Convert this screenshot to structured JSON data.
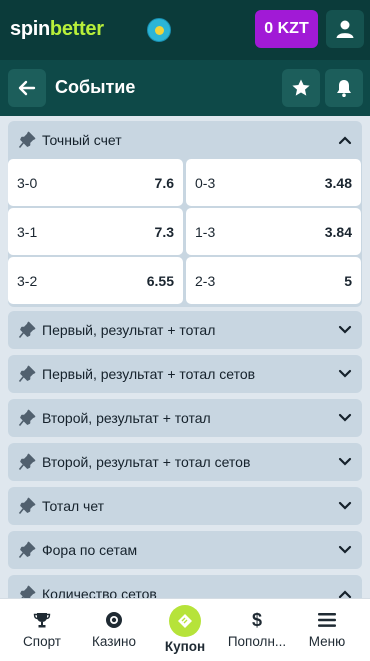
{
  "header": {
    "logo_part1": "spin",
    "logo_part2": "better",
    "flag_icon": "kazakhstan-flag-icon",
    "balance": "0 KZT",
    "user_icon": "user-icon"
  },
  "subheader": {
    "back_icon": "arrow-left-icon",
    "title": "Событие",
    "favorite_icon": "star-icon",
    "notify_icon": "bell-icon"
  },
  "markets": {
    "open_market": {
      "title": "Точный счет",
      "odds": [
        {
          "label": "3-0",
          "value": "7.6"
        },
        {
          "label": "0-3",
          "value": "3.48"
        },
        {
          "label": "3-1",
          "value": "7.3"
        },
        {
          "label": "1-3",
          "value": "3.84"
        },
        {
          "label": "3-2",
          "value": "6.55"
        },
        {
          "label": "2-3",
          "value": "5"
        }
      ]
    },
    "collapsed": [
      {
        "title": "Первый, результат + тотал"
      },
      {
        "title": "Первый, результат + тотал сетов"
      },
      {
        "title": "Второй, результат + тотал"
      },
      {
        "title": "Второй, результат + тотал сетов"
      },
      {
        "title": "Тотал чет"
      },
      {
        "title": "Фора по сетам"
      },
      {
        "title": "Количество сетов"
      }
    ]
  },
  "bottom_nav": {
    "items": [
      {
        "label": "Спорт",
        "icon": "trophy-icon"
      },
      {
        "label": "Казино",
        "icon": "casino-chip-icon"
      },
      {
        "label": "Купон",
        "icon": "ticket-icon"
      },
      {
        "label": "Пополн...",
        "icon": "dollar-icon"
      },
      {
        "label": "Меню",
        "icon": "menu-icon"
      }
    ]
  },
  "colors": {
    "header_bg": "#0b3b3a",
    "brand_green": "#b8ef3a",
    "balance_purple": "#a11ad6",
    "market_bg": "#c8d6e1"
  }
}
